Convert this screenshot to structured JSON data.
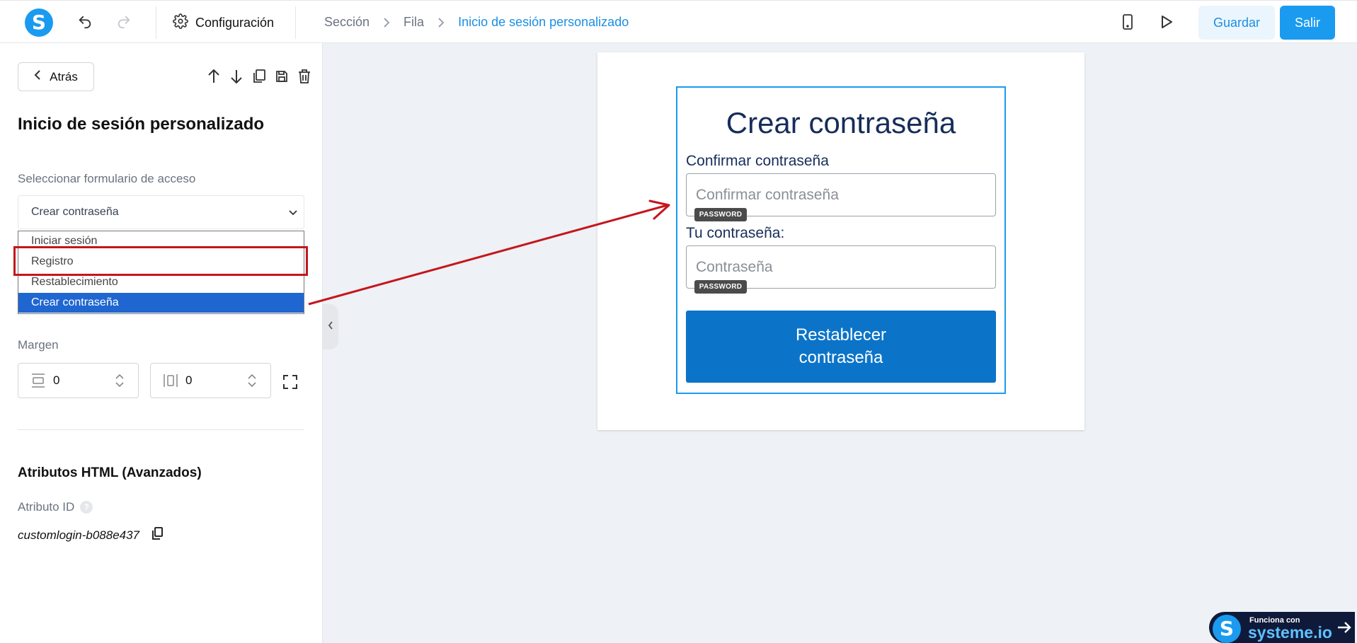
{
  "topbar": {
    "logo_letter": "S",
    "config_label": "Configuración",
    "breadcrumb": [
      "Sección",
      "Fila",
      "Inicio de sesión personalizado"
    ],
    "save_label": "Guardar",
    "exit_label": "Salir"
  },
  "sidebar": {
    "back_label": "Atrás",
    "title": "Inicio de sesión personalizado",
    "form_select_label": "Seleccionar formulario de acceso",
    "selected_value": "Crear contraseña",
    "options": [
      "Iniciar sesión",
      "Registro",
      "Restablecimiento",
      "Crear contraseña"
    ],
    "margin_label": "Margen",
    "margin_top": "0",
    "margin_side": "0",
    "advanced_title": "Atributos HTML (Avanzados)",
    "attr_id_label": "Atributo ID",
    "help_glyph": "?",
    "attr_id_value": "customlogin-b088e437"
  },
  "form": {
    "title": "Crear contraseña",
    "confirm_label": "Confirmar contraseña",
    "confirm_placeholder": "Confirmar contraseña",
    "password_label": "Tu contraseña:",
    "password_placeholder": "Contraseña",
    "badge": "PASSWORD",
    "submit_line1": "Restablecer",
    "submit_line2": "contraseña"
  },
  "powered": {
    "logo_letter": "S",
    "line1": "Funciona con",
    "line2": "systeme.io"
  },
  "colors": {
    "accent": "#1a9bf0",
    "form_button": "#0b74c8",
    "annotation_red": "#c4161c",
    "selected_option": "#1f66d1"
  }
}
